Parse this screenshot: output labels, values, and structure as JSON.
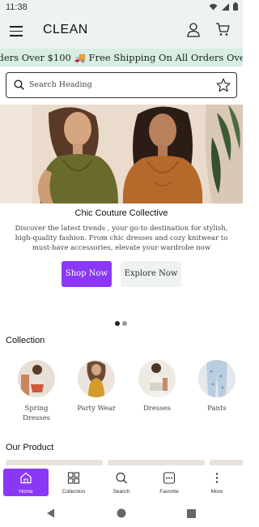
{
  "status_bar": {
    "time": "11:38"
  },
  "header": {
    "brand": "CLEAN"
  },
  "ticker": {
    "text": "rders Over $100  🚚 Free Shipping On All Orders Over $100"
  },
  "search": {
    "placeholder": "Search Heading"
  },
  "hero": {
    "title": "Chic Couture Collective",
    "description": "Discover the latest trends , your go-to destination for stylish, high-quality fashion. From chic dresses and cozy knitwear to must-have accessories, elevate your wardrobe now",
    "primary_button": "Shop Now",
    "secondary_button": "Explore Now",
    "slide_count": 2,
    "active_slide": 1
  },
  "collection": {
    "title": "Collection",
    "items": [
      {
        "label": "Spring Dresses"
      },
      {
        "label": "Party Wear"
      },
      {
        "label": "Dresses"
      },
      {
        "label": "Pants"
      }
    ]
  },
  "products": {
    "title": "Our Product"
  },
  "bottom_nav": {
    "items": [
      {
        "label": "Home",
        "icon": "home-icon",
        "active": true
      },
      {
        "label": "Collection",
        "icon": "grid-icon",
        "active": false
      },
      {
        "label": "Search",
        "icon": "search-icon",
        "active": false
      },
      {
        "label": "Favorite",
        "icon": "favorite-icon",
        "active": false
      },
      {
        "label": "More",
        "icon": "more-vertical-icon",
        "active": false
      }
    ]
  },
  "colors": {
    "accent": "#8a38f5",
    "header_bg": "#eef3f1",
    "ticker_bg": "#d7eee3"
  }
}
